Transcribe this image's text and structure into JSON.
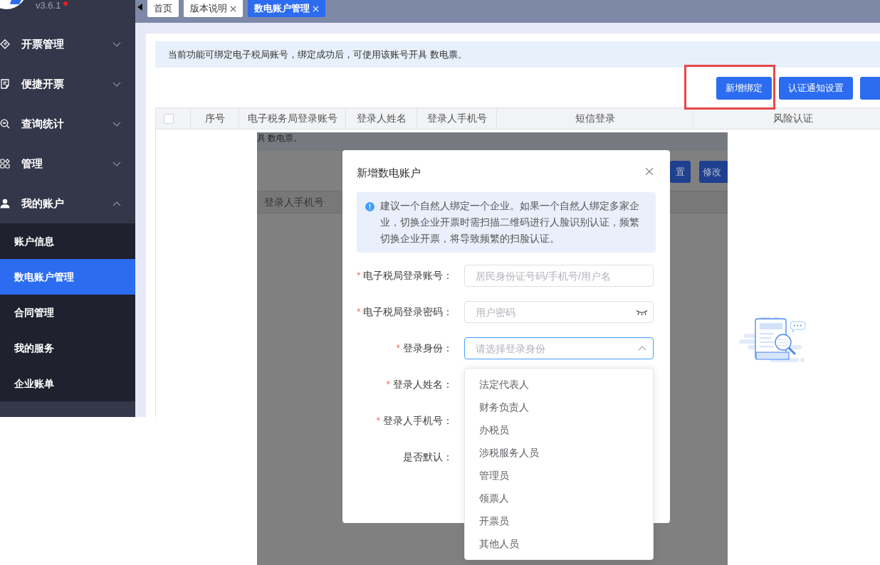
{
  "sidebar": {
    "version": "v3.6.1",
    "update_dot": true,
    "menu": [
      {
        "label": "开票管理",
        "expanded": false
      },
      {
        "label": "便捷开票",
        "expanded": false
      },
      {
        "label": "查询统计",
        "expanded": false
      },
      {
        "label": "管理",
        "expanded": false
      },
      {
        "label": "我的账户",
        "expanded": true,
        "children": [
          {
            "label": "账户信息",
            "selected": false
          },
          {
            "label": "数电账户管理",
            "selected": true
          },
          {
            "label": "合同管理",
            "selected": false
          },
          {
            "label": "我的服务",
            "selected": false
          },
          {
            "label": "企业账单",
            "selected": false
          }
        ]
      }
    ]
  },
  "tabs": [
    {
      "label": "首页",
      "closable": false,
      "selected": false
    },
    {
      "label": "版本说明",
      "closable": true,
      "selected": false
    },
    {
      "label": "数电账户管理",
      "closable": true,
      "selected": true
    }
  ],
  "notice": "当前功能可绑定电子税局账号，绑定成功后，可使用该账号开具 数电票。",
  "toolbar": [
    {
      "label": "新增绑定",
      "highlighted": true
    },
    {
      "label": "认证通知设置",
      "highlighted": false
    },
    {
      "highlighted": false
    }
  ],
  "table": {
    "select_all_checked": false,
    "columns": [
      "序号",
      "电子税务局登录账号",
      "登录人姓名",
      "登录人手机号",
      "短信登录",
      "风险认证"
    ]
  },
  "inset": {
    "notice_fragment": "具 数电票。",
    "buttons": [
      "置",
      "修改"
    ],
    "column": "登录人手机号",
    "dialog": {
      "title": "新增数电账户",
      "tip": "建议一个自然人绑定一个企业。如果一个自然人绑定多家企业，切换企业开票时需扫描二维码进行人脸识别认证，频繁切换企业开票，将导致频繁的扫脸认证。",
      "fields": [
        {
          "label": "电子税局登录账号：",
          "required_mark": "*",
          "kind": "text",
          "placeholder": "居民身份证号码/手机号/用户名"
        },
        {
          "label": "电子税局登录密码：",
          "required_mark": "*",
          "kind": "password",
          "placeholder": "用户密码"
        },
        {
          "label": "登录身份：",
          "required_mark": "*",
          "kind": "select",
          "placeholder": "请选择登录身份",
          "expanded": true,
          "options": [
            {
              "label": "法定代表人",
              "selected": false
            },
            {
              "label": "财务负责人",
              "selected": false
            },
            {
              "label": "办税员",
              "selected": false
            },
            {
              "label": "涉税服务人员",
              "selected": false
            },
            {
              "label": "管理员",
              "selected": false
            },
            {
              "label": "领票人",
              "selected": false
            },
            {
              "label": "开票员",
              "selected": false
            },
            {
              "label": "其他人员",
              "selected": false
            }
          ]
        },
        {
          "label": "登录人姓名：",
          "required_mark": "*",
          "kind": "covered"
        },
        {
          "label": "登录人手机号：",
          "required_mark": "*",
          "kind": "covered"
        },
        {
          "label": "是否默认：",
          "kind": "covered"
        }
      ]
    }
  }
}
